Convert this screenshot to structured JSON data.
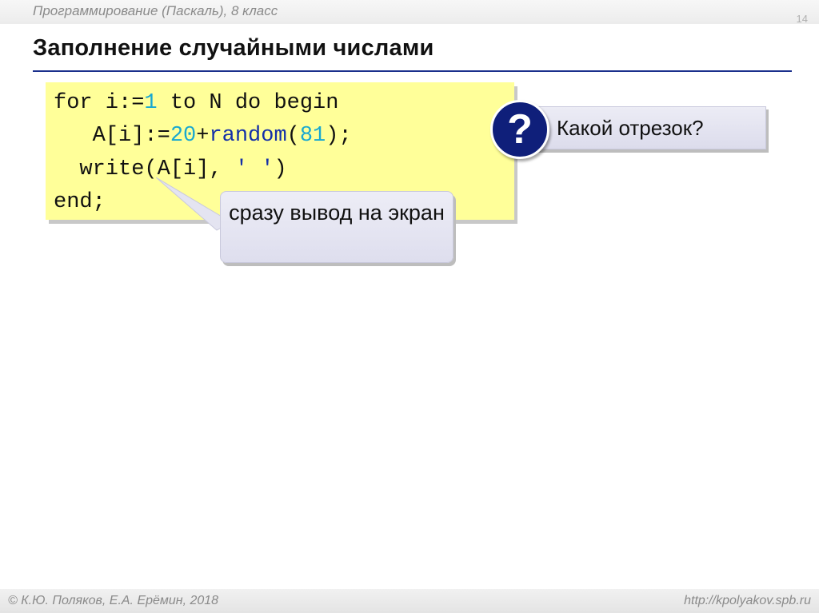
{
  "header": {
    "course": "Программирование (Паскаль), 8 класс",
    "slide_number": "14"
  },
  "title": "Заполнение случайными числами",
  "code": {
    "line1": {
      "for_part": "for i:=",
      "start": "1",
      "rest": " to N do begin"
    },
    "line2": {
      "indent": "   A[i]:=",
      "base": "20",
      "plus": "+",
      "func": "random",
      "open": "(",
      "arg": "81",
      "close": ");"
    },
    "line3": {
      "indent": "  write(A[i], ",
      "str": "' '",
      "close": ")"
    },
    "line4": {
      "text": "end;"
    }
  },
  "question_callout": {
    "badge": "?",
    "text": "Какой отрезок?"
  },
  "note_callout": {
    "text": "сразу вывод на экран"
  },
  "footer": {
    "left": "© К.Ю. Поляков, Е.А. Ерёмин, 2018",
    "right": "http://kpolyakov.spb.ru"
  },
  "colors": {
    "code_background": "#ffff99",
    "title_rule": "#1a2f8c",
    "number": "#19a8d0",
    "keyword": "#1530a8",
    "badge": "#0f1f7a"
  }
}
